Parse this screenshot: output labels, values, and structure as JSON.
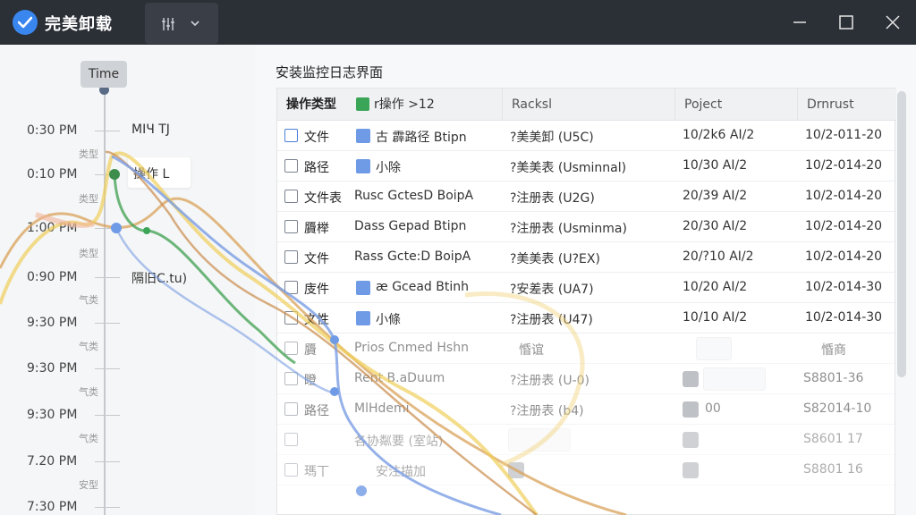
{
  "app": {
    "title": "完美卸载"
  },
  "left": {
    "header": "Time",
    "event_top": "MIЧ TJ",
    "event_box": "操作 L",
    "event_bottom": "隔旧C.tu)",
    "times": [
      "0:30 PM",
      "0:10 PM",
      "1:00 PM",
      "0:90 PM",
      "9:30 PM",
      "9:30 PM",
      "9:30 PM",
      "7.20 PM",
      "7:30 PM"
    ],
    "type_labels": [
      "类型",
      "类型",
      "类型",
      "气类",
      "气类",
      "气类",
      "气类",
      "安型"
    ]
  },
  "main": {
    "title": "安装监控日志界面",
    "columns": [
      "操作类型",
      "r操作 >12",
      "Racksl",
      "Poject",
      "Drnrust"
    ],
    "rows": [
      {
        "type": "文件",
        "name": "古 霹路径 Btipn",
        "rack": "?美美卸 (U5C)",
        "proj": "10/2k6 AI/2",
        "date": "10/2-011-20"
      },
      {
        "type": "路径",
        "name": "小除",
        "rack": "?美美表 (Usminnal)",
        "proj": "10/30 AI/2",
        "date": "10/2-014-20"
      },
      {
        "type": "文件表",
        "name": "Rusc GctesD BoipA",
        "rack": "?注册表 (U2G)",
        "proj": "20/39 AI/2",
        "date": "10/2-014-20"
      },
      {
        "type": "贗榉",
        "name": "Dass Gepad Btipn",
        "rack": "?注册表 (Usminma)",
        "proj": "20/30 AI/2",
        "date": "10/2-014-20"
      },
      {
        "type": "文件",
        "name": "Rass Gcte:D BoipA",
        "rack": "?美美表 (U?EX)",
        "proj": "20/?10 AI/2",
        "date": "10/2-014-20"
      },
      {
        "type": "庋件",
        "name": "æ Gcead Btinh",
        "rack": "?安差表 (UA7)",
        "proj": "10/20 AI/2",
        "date": "10/2-014-30"
      },
      {
        "type": "文性",
        "name": "小條",
        "rack": "?注册表 (U47)",
        "proj": "10/10 AI/2",
        "date": "10/2-014-30"
      },
      {
        "type": "贗",
        "name": "Prios Cnmed Hshn",
        "rack": "惛谊",
        "proj": "",
        "date": "惛商"
      },
      {
        "type": "瞪",
        "name": "Rent B.aDuum",
        "rack": "?注册表 (U-0)",
        "proj": "",
        "date": "S8801-36"
      },
      {
        "type": "路径",
        "name": "MlHdemi",
        "rack": "?注册表 (b4)",
        "proj": "00",
        "date": "S82014-10"
      },
      {
        "type": "",
        "name": "各协粼要 (室站)",
        "rack": "",
        "proj": "",
        "date": "S8601 17"
      },
      {
        "type": "瑪丅",
        "name": "安注描加",
        "rack": "",
        "proj": "",
        "date": "S8801 16"
      }
    ]
  },
  "colors": {
    "titlebar": "#2b2f36",
    "accent_blue": "#3a86ef",
    "green": "#3aa556",
    "square_blue": "#6f9ae6"
  },
  "icons": [
    "check-logo-icon",
    "settings-sliders-icon",
    "chevron-down-icon",
    "minimize-icon",
    "maximize-icon",
    "close-icon"
  ]
}
